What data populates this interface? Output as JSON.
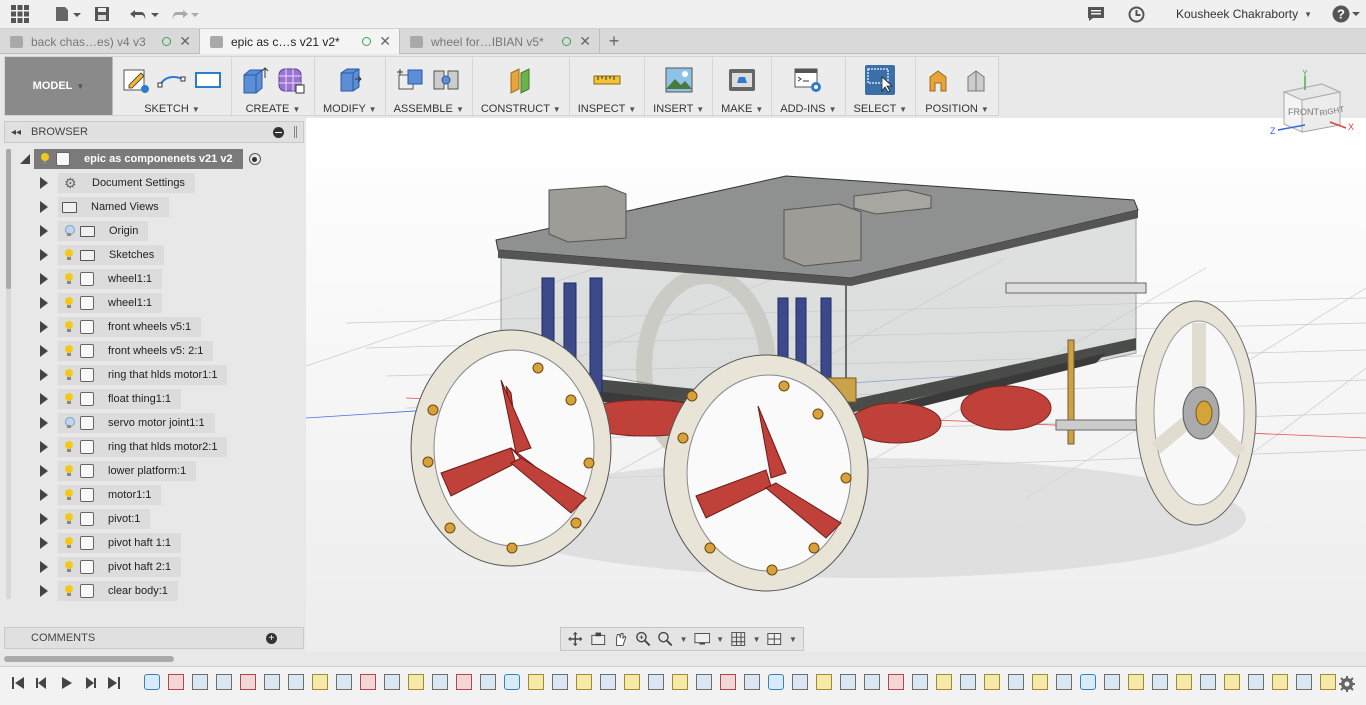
{
  "topbar": {
    "user_name": "Kousheek Chakraborty"
  },
  "tabs": [
    {
      "label": "back chas…es) v4 v3",
      "active": false
    },
    {
      "label": "epic as c…s v21 v2*",
      "active": true
    },
    {
      "label": "wheel for…IBIAN v5*",
      "active": false
    }
  ],
  "toolbar": {
    "model_label": "MODEL",
    "groups": [
      {
        "label": "SKETCH"
      },
      {
        "label": "CREATE"
      },
      {
        "label": "MODIFY"
      },
      {
        "label": "ASSEMBLE"
      },
      {
        "label": "CONSTRUCT"
      },
      {
        "label": "INSPECT"
      },
      {
        "label": "INSERT"
      },
      {
        "label": "MAKE"
      },
      {
        "label": "ADD-INS"
      },
      {
        "label": "SELECT"
      },
      {
        "label": "POSITION"
      }
    ]
  },
  "browser": {
    "title": "BROWSER",
    "root": "epic as componenets v21 v2",
    "items": [
      {
        "label": "Document Settings",
        "icon": "gear-icon"
      },
      {
        "label": "Named Views",
        "icon": "folder-icon"
      },
      {
        "label": "Origin",
        "icon": "folder-icon",
        "bulb": "off"
      },
      {
        "label": "Sketches",
        "icon": "folder-icon",
        "bulb": "on"
      },
      {
        "label": "wheel1:1",
        "icon": "component-icon",
        "bulb": "on"
      },
      {
        "label": "wheel1:1",
        "icon": "component-icon",
        "bulb": "on"
      },
      {
        "label": "front wheels v5:1",
        "icon": "component-icon",
        "bulb": "on"
      },
      {
        "label": "front wheels v5: 2:1",
        "icon": "component-icon",
        "bulb": "on"
      },
      {
        "label": "ring that hlds motor1:1",
        "icon": "component-icon",
        "bulb": "on"
      },
      {
        "label": "float thing1:1",
        "icon": "component-icon",
        "bulb": "on"
      },
      {
        "label": "servo motor joint1:1",
        "icon": "component-icon",
        "bulb": "off"
      },
      {
        "label": "ring that hlds motor2:1",
        "icon": "component-icon",
        "bulb": "on"
      },
      {
        "label": "lower platform:1",
        "icon": "component-icon",
        "bulb": "on"
      },
      {
        "label": "motor1:1",
        "icon": "component-icon",
        "bulb": "on"
      },
      {
        "label": "pivot:1",
        "icon": "component-icon",
        "bulb": "on"
      },
      {
        "label": "pivot haft 1:1",
        "icon": "component-icon",
        "bulb": "on"
      },
      {
        "label": "pivot haft 2:1",
        "icon": "component-icon",
        "bulb": "on"
      },
      {
        "label": "clear body:1",
        "icon": "component-icon",
        "bulb": "on"
      }
    ]
  },
  "comments": {
    "title": "COMMENTS"
  },
  "viewcube": {
    "front": "FRONT",
    "right": "RIGHT",
    "x": "X",
    "y": "Y",
    "z": "Z"
  },
  "colors": {
    "accent": "#3b6fa8",
    "bulb": "#f3c81c",
    "propeller": "#c0413a"
  }
}
